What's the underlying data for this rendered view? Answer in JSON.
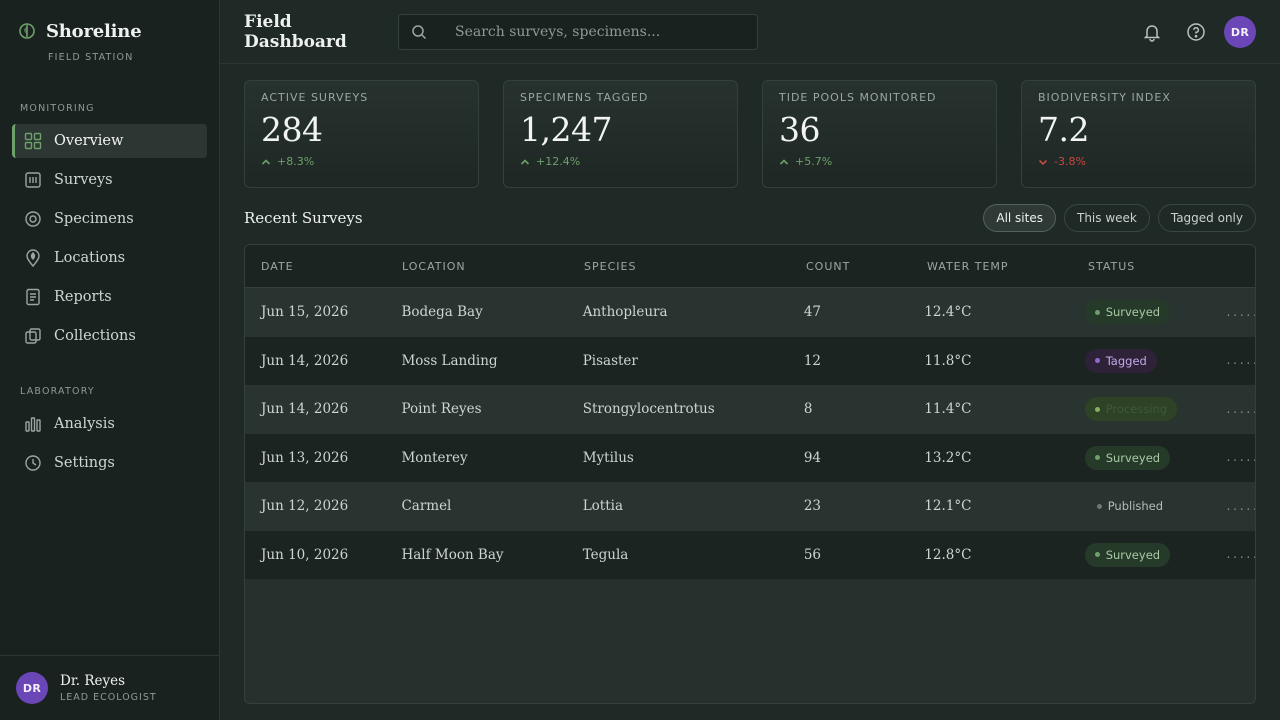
{
  "brand": {
    "name": "Shoreline",
    "subtitle": "FIELD STATION"
  },
  "sidebar": {
    "sections": [
      {
        "label": "MONITORING",
        "items": [
          {
            "label": "Overview",
            "icon": "grid-icon",
            "active": true
          },
          {
            "label": "Surveys",
            "icon": "survey-icon"
          },
          {
            "label": "Specimens",
            "icon": "target-icon"
          },
          {
            "label": "Locations",
            "icon": "pin-icon"
          },
          {
            "label": "Reports",
            "icon": "report-icon"
          },
          {
            "label": "Collections",
            "icon": "collection-icon"
          }
        ]
      },
      {
        "label": "LABORATORY",
        "items": [
          {
            "label": "Analysis",
            "icon": "bar-chart-icon"
          },
          {
            "label": "Settings",
            "icon": "clock-icon"
          }
        ]
      }
    ],
    "user": {
      "initials": "DR",
      "name": "Dr. Reyes",
      "role": "LEAD ECOLOGIST"
    }
  },
  "header": {
    "title": "Field Dashboard",
    "search_placeholder": "Search surveys, specimens...",
    "avatar_initials": "DR"
  },
  "stats": [
    {
      "label": "ACTIVE SURVEYS",
      "value": "284",
      "delta": "+8.3%",
      "trend": "up"
    },
    {
      "label": "SPECIMENS TAGGED",
      "value": "1,247",
      "delta": "+12.4%",
      "trend": "up"
    },
    {
      "label": "TIDE POOLS MONITORED",
      "value": "36",
      "delta": "+5.7%",
      "trend": "up"
    },
    {
      "label": "BIODIVERSITY INDEX",
      "value": "7.2",
      "delta": "-3.8%",
      "trend": "down"
    }
  ],
  "recent": {
    "title": "Recent Surveys",
    "filters": [
      "All sites",
      "This week",
      "Tagged only"
    ],
    "active_filter": "All sites",
    "columns": [
      "DATE",
      "LOCATION",
      "SPECIES",
      "COUNT",
      "WATER TEMP",
      "STATUS"
    ],
    "rows": [
      {
        "date": "Jun 15, 2026",
        "location": "Bodega Bay",
        "species": "Anthopleura",
        "count": "47",
        "temp": "12.4°C",
        "status": "Surveyed",
        "more": "........"
      },
      {
        "date": "Jun 14, 2026",
        "location": "Moss Landing",
        "species": "Pisaster",
        "count": "12",
        "temp": "11.8°C",
        "status": "Tagged",
        "more": "........"
      },
      {
        "date": "Jun 14, 2026",
        "location": "Point Reyes",
        "species": "Strongylocentrotus",
        "count": "8",
        "temp": "11.4°C",
        "status": "Processing",
        "more": "........"
      },
      {
        "date": "Jun 13, 2026",
        "location": "Monterey",
        "species": "Mytilus",
        "count": "94",
        "temp": "13.2°C",
        "status": "Surveyed",
        "more": "........"
      },
      {
        "date": "Jun 12, 2026",
        "location": "Carmel",
        "species": "Lottia",
        "count": "23",
        "temp": "12.1°C",
        "status": "Published",
        "more": "........"
      },
      {
        "date": "Jun 10, 2026",
        "location": "Half Moon Bay",
        "species": "Tegula",
        "count": "56",
        "temp": "12.8°C",
        "status": "Surveyed",
        "more": "........"
      }
    ]
  },
  "colors": {
    "accent": "#6ea06b",
    "avatar": "#6b46b6",
    "negative": "#c4493f",
    "tagged": "#9466d0"
  }
}
